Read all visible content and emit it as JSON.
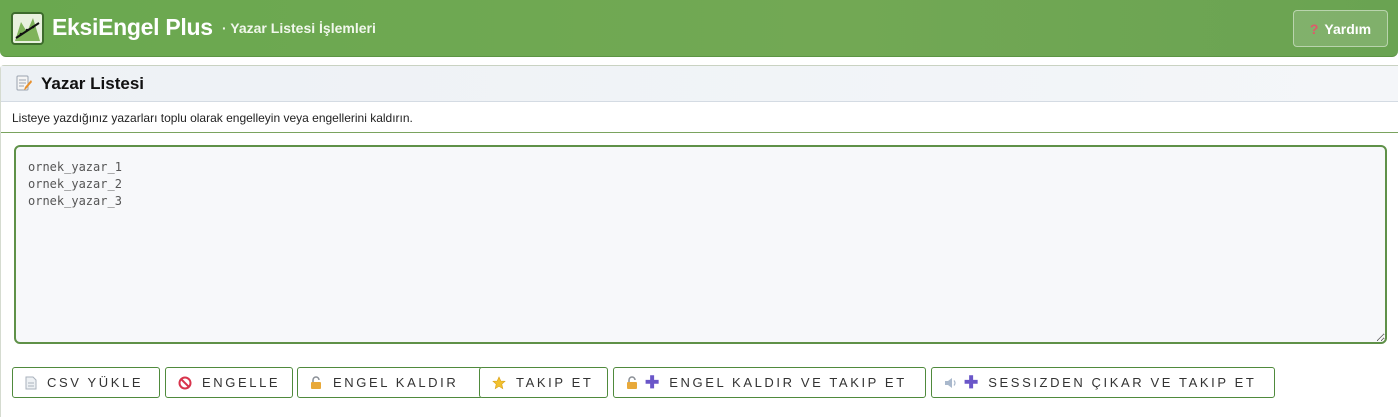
{
  "header": {
    "brand": "EksiEngel Plus",
    "subtitle": "· Yazar Listesi İşlemleri",
    "help_label": "Yardım",
    "icons": {
      "logo": "eksiengel-logo-icon",
      "help": "question-mark-icon"
    }
  },
  "panel": {
    "title": "Yazar Listesi",
    "title_icon": "memo-pencil-icon",
    "description": "Listeye yazdığınız yazarları toplu olarak engelleyin veya engellerini kaldırın.",
    "textarea_value": "ornek_yazar_1\nornek_yazar_2\nornek_yazar_3"
  },
  "buttons": {
    "csv": {
      "label": "CSV YÜKLE",
      "icon": "document-icon"
    },
    "block": {
      "label": "ENGELLE",
      "icon": "prohibited-icon"
    },
    "unblock": {
      "label": "ENGEL KALDIR",
      "icon": "unlocked-icon"
    },
    "follow": {
      "label": "TAKIP ET",
      "icon": "star-icon"
    },
    "unblock_follow": {
      "label": "ENGEL KALDIR VE TAKIP ET",
      "icons": [
        "unlocked-icon",
        "plus-icon"
      ]
    },
    "unmute_follow": {
      "label": "SESSIZDEN ÇIKAR VE TAKIP ET",
      "icons": [
        "speaker-icon",
        "plus-icon"
      ]
    }
  },
  "colors": {
    "header_green": "#6aa84f",
    "button_border": "#4f8a3c",
    "accent_purple": "#6a56c8"
  }
}
